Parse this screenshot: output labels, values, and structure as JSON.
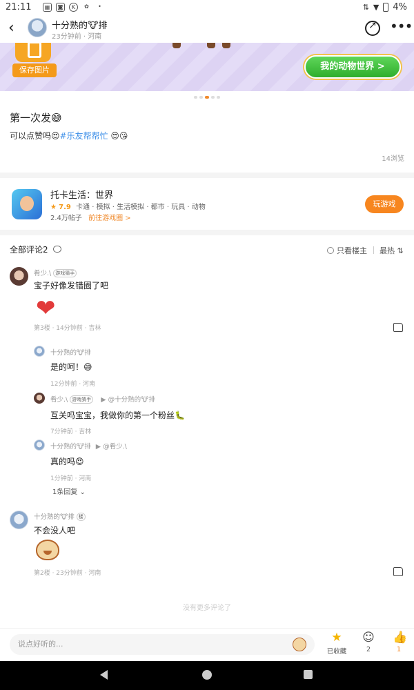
{
  "status_bar": {
    "time": "21:11",
    "battery": "4%"
  },
  "header": {
    "author": "十分熟的🐮排",
    "meta": "23分钟前 · 河南"
  },
  "banner": {
    "save_label": "保存图片",
    "world_button": "我的动物世界 >"
  },
  "post": {
    "title": "第一次发😅",
    "body_prefix": "可以点赞吗😍",
    "tag": "#乐友帮帮忙",
    "body_suffix": "😍😘",
    "views": "14浏览"
  },
  "game": {
    "name": "托卡生活：世界",
    "rating": "7.9",
    "genres": "卡通 · 模拟 · 生活模拟 · 都市 · 玩具 · 动物",
    "posts": "2.4万帖子",
    "goto": "前往游戏圈 >",
    "play": "玩游戏"
  },
  "comments_header": {
    "title": "全部评论2",
    "only_owner": "只看楼主",
    "sort": "最热 ⇅"
  },
  "comments": [
    {
      "user": "肴少.\\",
      "badge": "游戏猜手",
      "text": "宝子好像发错圈了吧",
      "meta": "第3楼 · 14分钟前 · 吉林",
      "replies": [
        {
          "user": "十分熟的🐮排",
          "text": "是的呵！😅",
          "meta": "12分钟前 · 河南"
        },
        {
          "user": "肴少.\\",
          "badge": "游戏猜手",
          "reply_to": "▶ @十分熟的🐮排",
          "text": "互关吗宝宝，我做你的第一个粉丝🐛",
          "meta": "7分钟前 · 吉林"
        },
        {
          "user": "十分熟的🐮排",
          "reply_to": "▶ @肴少.\\",
          "text": "真的吗😍",
          "meta": "1分钟前 · 河南"
        }
      ],
      "more_replies": "1条回复 ⌄"
    },
    {
      "user": "十分熟的🐮排",
      "badge": "楼",
      "text": "不会没人吧",
      "meta": "第2楼 · 23分钟前 · 河南"
    }
  ],
  "no_more": "没有更多评论了",
  "bottom_bar": {
    "placeholder": "说点好听的...",
    "favorite_label": "已收藏",
    "comment_count": "2",
    "like_count": "1"
  },
  "colors": {
    "accent": "#f7861f",
    "tag_blue": "#3b8ee8",
    "green_button": "#2fae2c"
  }
}
